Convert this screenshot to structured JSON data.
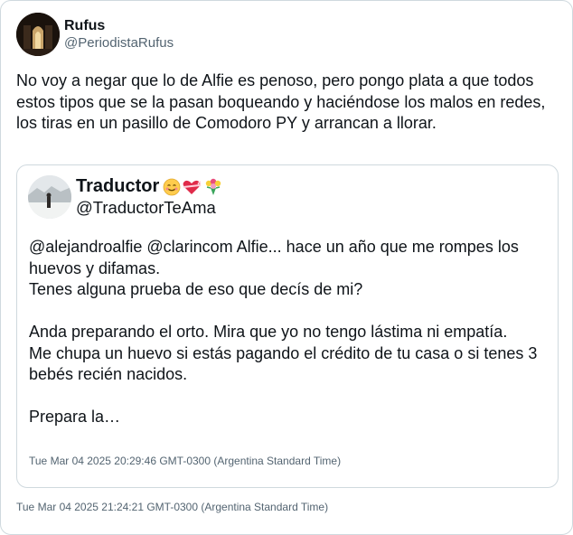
{
  "tweet": {
    "display_name": "Rufus",
    "handle": "@PeriodistaRufus",
    "text": "No voy a negar que lo de Alfie es penoso, pero pongo plata a que todos estos tipos que se la pasan boqueando y haciéndose los malos en redes, los tiras en un pasillo de Comodoro PY y arrancan a llorar.",
    "timestamp": "Tue Mar 04 2025 21:24:21 GMT-0300 (Argentina Standard Time)"
  },
  "quoted": {
    "display_name": "Traductor",
    "emojis": [
      "smiling-face-with-hearts",
      "heart-with-ribbon",
      "bouquet-of-flowers"
    ],
    "handle": "@TraductorTeAma",
    "text": "@alejandroalfie @clarincom Alfie... hace un año que me rompes los huevos y difamas.\nTenes alguna prueba de eso que decís de mi?\n\nAnda preparando el orto. Mira que yo no tengo lástima ni empatía.\nMe chupa un huevo si estás pagando el crédito de tu casa o si tenes 3 bebés recién nacidos.\n\nPrepara la…",
    "timestamp": "Tue Mar 04 2025 20:29:46 GMT-0300 (Argentina Standard Time)"
  }
}
